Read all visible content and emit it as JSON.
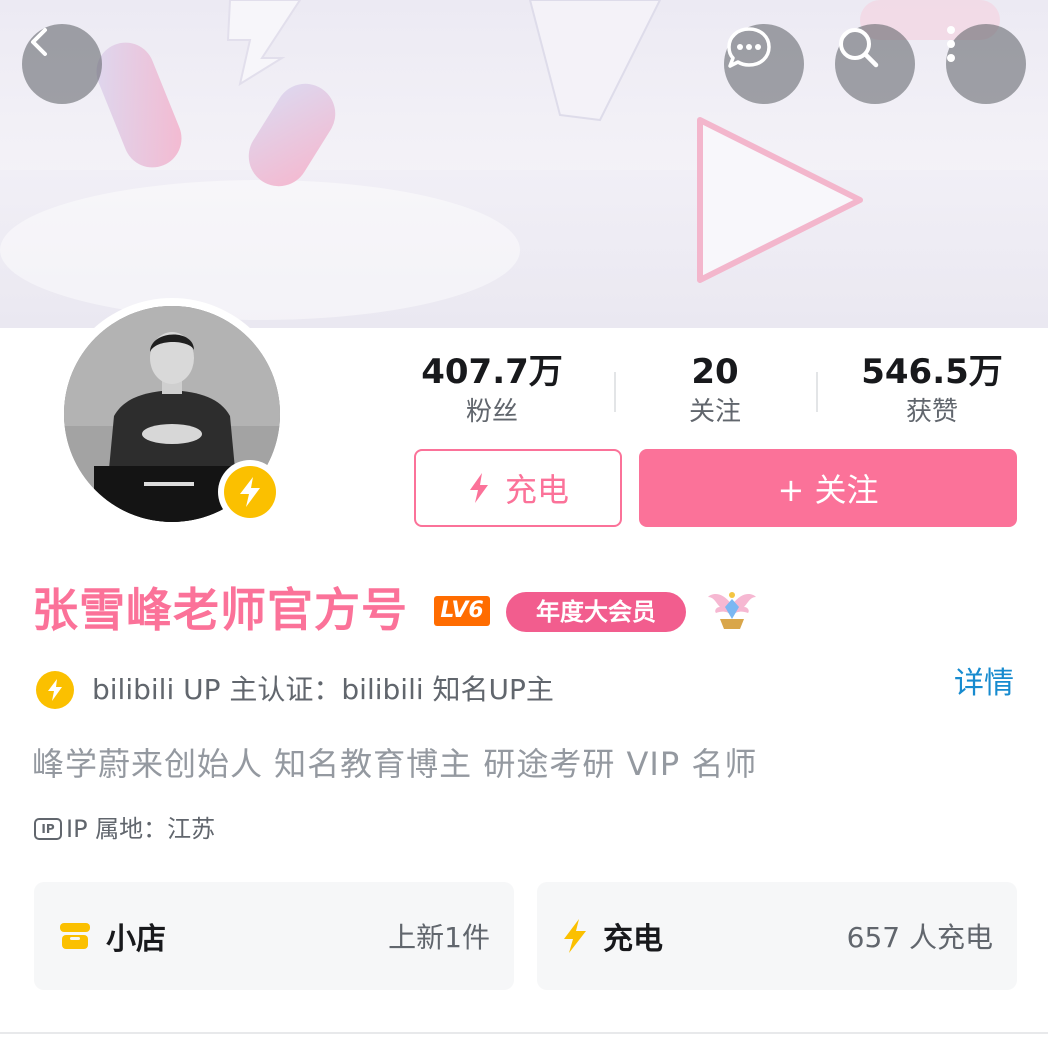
{
  "header": {
    "back_icon": "chevron-left-icon",
    "message_icon": "chat-bubble-icon",
    "search_icon": "search-icon",
    "more_icon": "more-vertical-icon"
  },
  "stats": [
    {
      "value": "407.7万",
      "label": "粉丝"
    },
    {
      "value": "20",
      "label": "关注"
    },
    {
      "value": "546.5万",
      "label": "获赞"
    }
  ],
  "actions": {
    "charge_label": "充电",
    "follow_label": "+ 关注"
  },
  "profile": {
    "name": "张雪峰老师官方号",
    "level_badge": "LV6",
    "vip_badge": "年度大会员",
    "verification": "bilibili UP 主认证：bilibili 知名UP主",
    "detail_link": "详情",
    "bio": "峰学蔚来创始人 知名教育博主 研途考研 VIP 名师",
    "ip_icon_text": "IP",
    "ip_location": "IP 属地：江苏"
  },
  "cards": [
    {
      "title": "小店",
      "meta": "上新1件",
      "icon": "shop-icon"
    },
    {
      "title": "充电",
      "meta": "657 人充电",
      "icon": "lightning-icon"
    }
  ],
  "colors": {
    "brand_pink": "#fb7299",
    "vip_pink": "#f25d8e",
    "verify_yellow": "#fbc000",
    "link_blue": "#178bcf",
    "level_orange": "#ff6c00"
  }
}
